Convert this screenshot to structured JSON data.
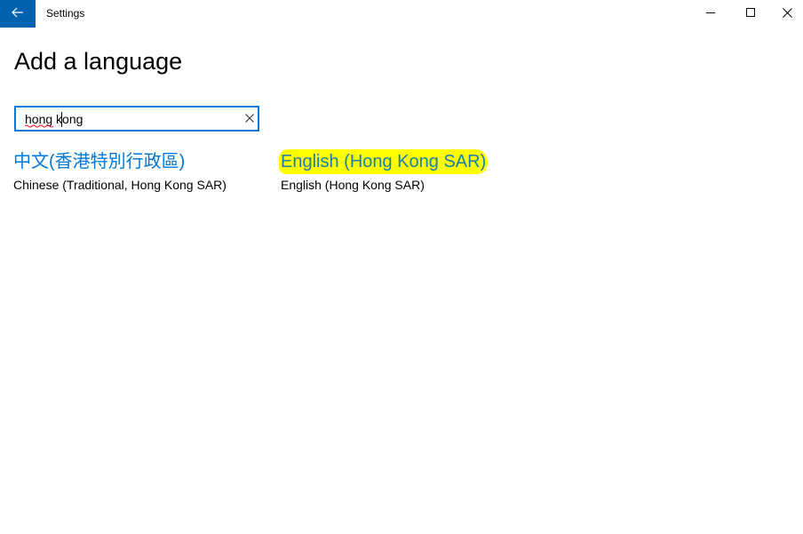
{
  "window": {
    "title": "Settings",
    "back_icon": "arrow-left-icon",
    "minimize_icon": "minimize-icon",
    "maximize_icon": "maximize-icon",
    "close_icon": "close-icon",
    "accent_color": "#0063b1"
  },
  "page": {
    "title": "Add a language"
  },
  "search": {
    "value": "hong kong",
    "clear_icon": "close-icon",
    "border_color": "#0078d7"
  },
  "results": [
    {
      "native_name": "中文(香港特別行政區)",
      "english_name": "Chinese (Traditional, Hong Kong SAR)"
    },
    {
      "native_name": "English (Hong Kong SAR)",
      "english_name": "English (Hong Kong SAR)",
      "highlight_color": "#ffff00"
    }
  ],
  "colors": {
    "link_blue": "#0078d7",
    "highlight": "#ffff00"
  }
}
